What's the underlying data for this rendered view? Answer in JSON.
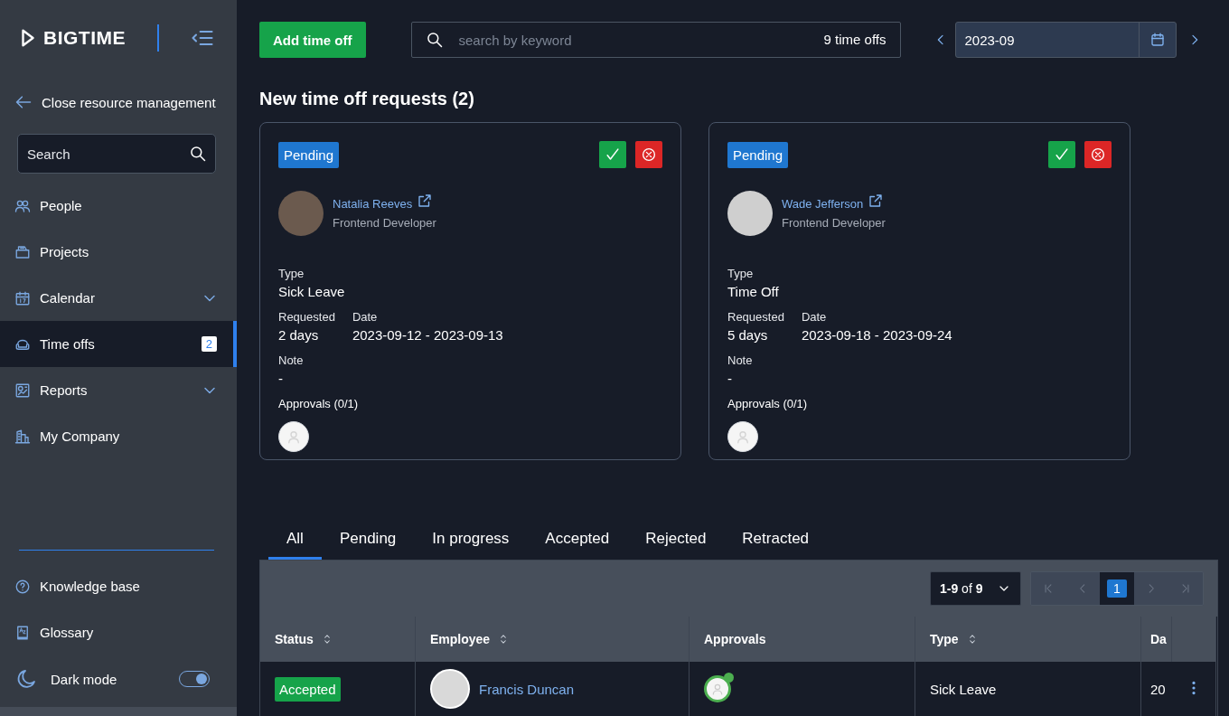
{
  "sidebar": {
    "logo": "BIGTIME",
    "back_link": "Close resource management",
    "search": {
      "placeholder": "Search"
    },
    "items": [
      {
        "label": "People",
        "selected": false,
        "expandable": false
      },
      {
        "label": "Projects",
        "selected": false,
        "expandable": false
      },
      {
        "label": "Calendar",
        "selected": false,
        "expandable": true
      },
      {
        "label": "Time offs",
        "selected": true,
        "expandable": false,
        "badge": "2"
      },
      {
        "label": "Reports",
        "selected": false,
        "expandable": true
      },
      {
        "label": "My Company",
        "selected": false,
        "expandable": false
      }
    ],
    "footer_items": [
      {
        "label": "Knowledge base"
      },
      {
        "label": "Glossary"
      }
    ],
    "dark_mode": {
      "label": "Dark mode",
      "on": true
    }
  },
  "toolbar": {
    "add_button": "Add time off",
    "search": {
      "placeholder": "search by keyword"
    },
    "count": "9 time offs",
    "month": "2023-09"
  },
  "requests": {
    "title": "New time off requests (2)",
    "cards": [
      {
        "status": "Pending",
        "name": "Natalia Reeves",
        "role": "Frontend Developer",
        "type_label": "Type",
        "type": "Sick Leave",
        "requested_label": "Requested",
        "requested": "2 days",
        "date_label": "Date",
        "date": "2023-09-12 - 2023-09-13",
        "note_label": "Note",
        "note": "-",
        "approvals_label": "Approvals (0/1)"
      },
      {
        "status": "Pending",
        "name": "Wade Jefferson",
        "role": "Frontend Developer",
        "type_label": "Type",
        "type": "Time Off",
        "requested_label": "Requested",
        "requested": "5 days",
        "date_label": "Date",
        "date": "2023-09-18 - 2023-09-24",
        "note_label": "Note",
        "note": "-",
        "approvals_label": "Approvals (0/1)"
      }
    ]
  },
  "tabs": [
    {
      "label": "All",
      "selected": true
    },
    {
      "label": "Pending",
      "selected": false
    },
    {
      "label": "In progress",
      "selected": false
    },
    {
      "label": "Accepted",
      "selected": false
    },
    {
      "label": "Rejected",
      "selected": false
    },
    {
      "label": "Retracted",
      "selected": false
    }
  ],
  "table": {
    "range": "**1-9** of **9**",
    "current_page": "1",
    "columns": [
      {
        "label": "Status",
        "sortable": true
      },
      {
        "label": "Employee",
        "sortable": true
      },
      {
        "label": "Approvals",
        "sortable": false
      },
      {
        "label": "Type",
        "sortable": true
      },
      {
        "label": "Da"
      }
    ],
    "rows": [
      {
        "status": "Accepted",
        "employee": "Francis Duncan",
        "approved": true,
        "type": "Sick Leave",
        "date": "20"
      }
    ]
  }
}
